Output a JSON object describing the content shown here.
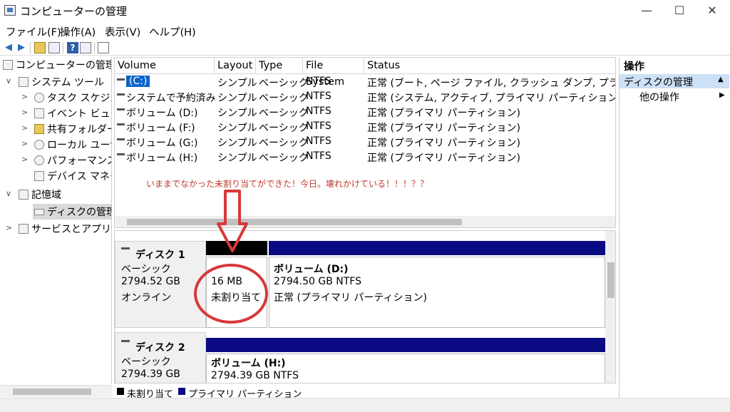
{
  "window": {
    "title": "コンピューターの管理",
    "minimize": "—",
    "maximize": "☐",
    "close": "✕"
  },
  "menu": [
    "ファイル(F)",
    "操作(A)",
    "表示(V)",
    "ヘルプ(H)"
  ],
  "tree": {
    "root": "コンピューターの管理 (ロ",
    "system_tools": "システム ツール",
    "task_scheduler": "タスク スケジュー",
    "event_viewer": "イベント ビューア",
    "shared_folders": "共有フォルダー",
    "local_users": "ローカル ユーザー",
    "performance": "パフォーマンス",
    "device_manager": "デバイス マネージ",
    "storage": "記憶域",
    "disk_management": "ディスクの管理",
    "services": "サービスとアプリケー"
  },
  "list": {
    "headers": [
      "Volume",
      "Layout",
      "Type",
      "File System",
      "Status"
    ],
    "rows": [
      {
        "volume": "(C:)",
        "layout": "シンプル",
        "type": "ベーシック",
        "fs": "NTFS",
        "status": "正常 (ブート, ページ ファイル, クラッシュ ダンプ, プライマリ パー"
      },
      {
        "volume": "システムで予約済み",
        "layout": "シンプル",
        "type": "ベーシック",
        "fs": "NTFS",
        "status": "正常 (システム, アクティブ, プライマリ パーティション)"
      },
      {
        "volume": "ボリューム (D:)",
        "layout": "シンプル",
        "type": "ベーシック",
        "fs": "NTFS",
        "status": "正常 (プライマリ パーティション)"
      },
      {
        "volume": "ボリューム (F:)",
        "layout": "シンプル",
        "type": "ベーシック",
        "fs": "NTFS",
        "status": "正常 (プライマリ パーティション)"
      },
      {
        "volume": "ボリューム (G:)",
        "layout": "シンプル",
        "type": "ベーシック",
        "fs": "NTFS",
        "status": "正常 (プライマリ パーティション)"
      },
      {
        "volume": "ボリューム (H:)",
        "layout": "シンプル",
        "type": "ベーシック",
        "fs": "NTFS",
        "status": "正常 (プライマリ パーティション)"
      }
    ],
    "annotation": "いままでなかった未割り当てができた！今日。壊れかけている！！！？？"
  },
  "disks": {
    "disk1": {
      "name": "ディスク 1",
      "type": "ベーシック",
      "size": "2794.52 GB",
      "state": "オンライン",
      "unalloc_size": "16 MB",
      "unalloc_label": "未割り当て",
      "vol_name": "ボリューム  (D:)",
      "vol_size": "2794.50 GB NTFS",
      "vol_status": "正常 (プライマリ パーティション)"
    },
    "disk2": {
      "name": "ディスク 2",
      "type": "ベーシック",
      "size": "2794.39 GB",
      "vol_name": "ボリューム  (H:)",
      "vol_size": "2794.39 GB NTFS"
    }
  },
  "legend": {
    "unallocated": "未割り当て",
    "primary": "プライマリ パーティション"
  },
  "actions": {
    "title": "操作",
    "selected": "ディスクの管理",
    "other": "他の操作"
  },
  "colors": {
    "primary_partition": "#0a0a82",
    "unallocated": "#000000",
    "annotation": "#c0392b",
    "selection": "#0a64c8"
  }
}
